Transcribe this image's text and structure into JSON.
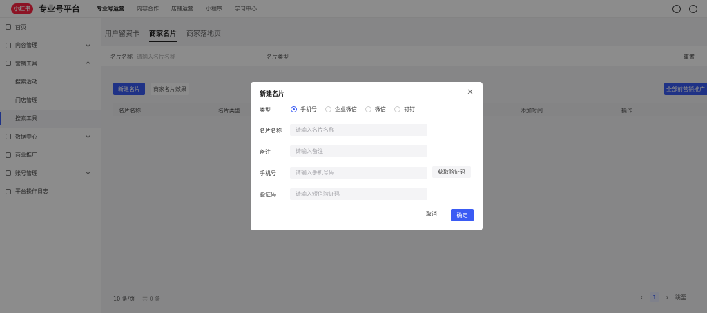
{
  "topbar": {
    "logo_text": "小红书",
    "brand": "专业号平台",
    "nav": [
      "专业号运营",
      "内容合作",
      "店铺运营",
      "小程序",
      "学习中心"
    ],
    "active_nav": 0
  },
  "sidebar": {
    "items": [
      {
        "label": "首页",
        "sub": false
      },
      {
        "label": "内容管理",
        "sub": false,
        "chevron": "down"
      },
      {
        "label": "营销工具",
        "sub": false,
        "chevron": "up"
      },
      {
        "label": "搜索活动",
        "sub": true
      },
      {
        "label": "门店管理",
        "sub": true
      },
      {
        "label": "搜索工具",
        "sub": true,
        "active": true
      },
      {
        "label": "数据中心",
        "sub": false,
        "chevron": "down"
      },
      {
        "label": "商业推广",
        "sub": false
      },
      {
        "label": "账号管理",
        "sub": false,
        "chevron": "down"
      },
      {
        "label": "平台操作日志",
        "sub": false
      }
    ]
  },
  "main": {
    "tabs": [
      "用户留资卡",
      "商家名片",
      "商家落地页"
    ],
    "active_tab": 1,
    "filter": {
      "name_label": "名片名称",
      "name_placeholder": "请输入名片名称",
      "type_label": "名片类型",
      "reset": "重置"
    },
    "actions": {
      "new": "新建名片",
      "effect": "商家名片效果",
      "right": "全部前营销推广"
    },
    "table_headers": [
      "名片名称",
      "名片类型",
      "添加时间",
      "操作"
    ],
    "pagination": {
      "page_size": "10 条/页",
      "total": "共 0 条",
      "current_page": "1",
      "jump": "跳至"
    }
  },
  "modal": {
    "title": "新建名片",
    "close_icon": "×",
    "type_label": "类型",
    "type_options": [
      "手机号",
      "企业微信",
      "微信",
      "钉钉"
    ],
    "type_selected": 0,
    "name_label": "名片名称",
    "name_placeholder": "请输入名片名称",
    "note_label": "备注",
    "note_placeholder": "请输入备注",
    "phone_label": "手机号",
    "phone_placeholder": "请输入手机号码",
    "get_code": "获取验证码",
    "code_label": "验证码",
    "code_placeholder": "请输入短信验证码",
    "cancel": "取消",
    "ok": "确定"
  },
  "colors": {
    "primary": "#3a5bf4",
    "brand_red": "#ff2442"
  }
}
